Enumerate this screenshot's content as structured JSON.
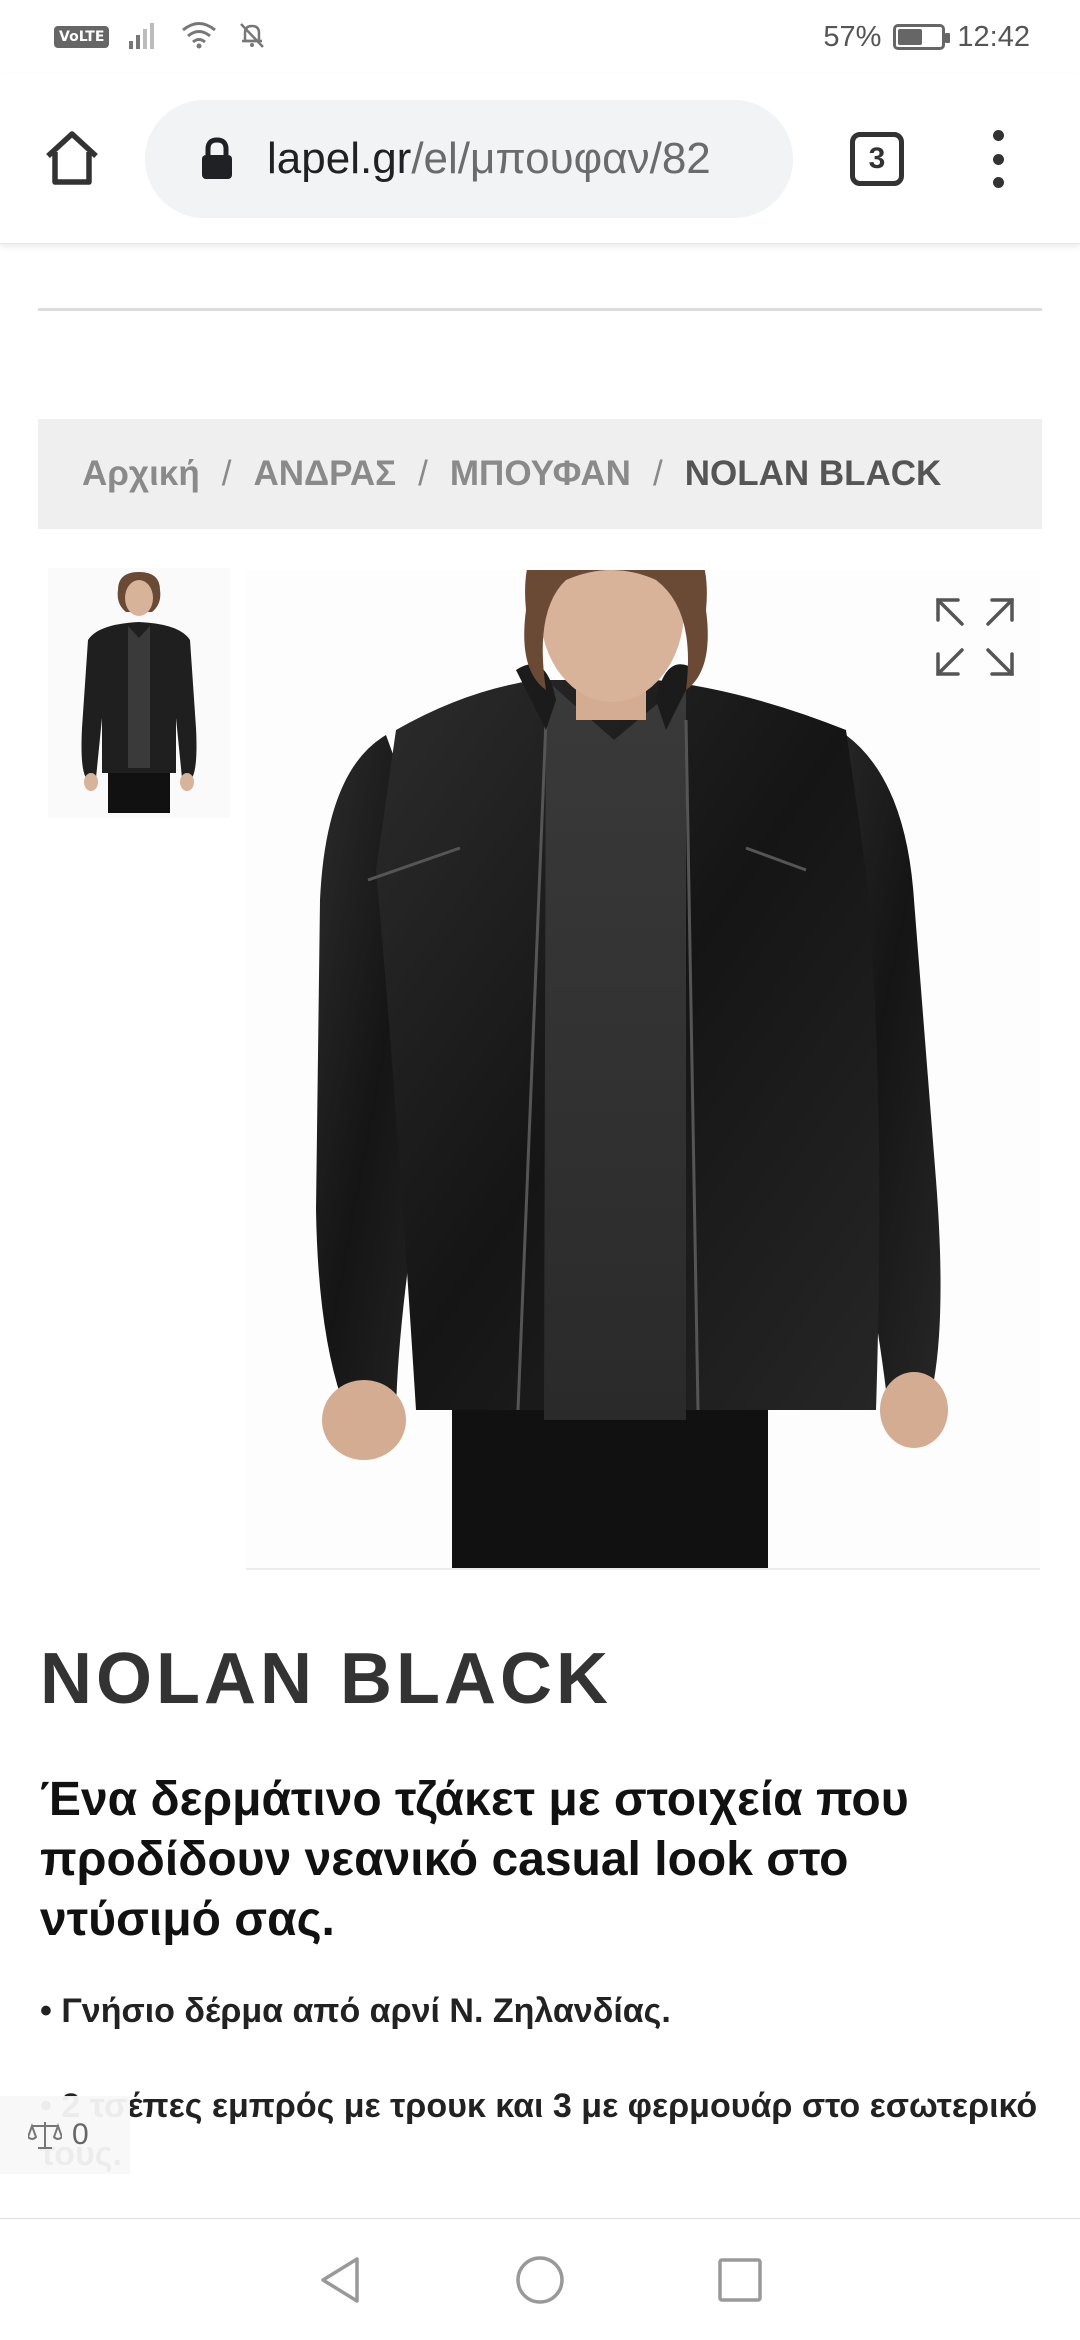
{
  "status_bar": {
    "network_badge": "VoLTE",
    "battery": "57%",
    "battery_level": 0.57,
    "time": "12:42"
  },
  "browser": {
    "url_domain": "lapel.gr",
    "url_path": "/el/μπουφαν/82",
    "tab_count": "3"
  },
  "breadcrumb": {
    "items": [
      "Αρχική",
      "ΑΝΔΡΑΣ",
      "ΜΠΟΥΦΑΝ",
      "NOLAN BLACK"
    ],
    "separator": "/"
  },
  "product": {
    "title": "NOLAN BLACK",
    "description": "Ένα δερμάτινο τζάκετ με στοιχεία που προδίδουν νεανικό casual look  στο ντύσιμό σας.",
    "bullets": [
      "• Γνήσιο δέρμα από αρνί Ν. Ζηλανδίας.",
      "• 2 τσέπες εμπρός με τρουκ και 3 με φερμουάρ στο εσωτερικό τους."
    ]
  },
  "compare": {
    "count": "0"
  },
  "icons": {
    "home": "home-icon",
    "lock": "lock-icon",
    "menu": "more-vert-icon",
    "expand": "fullscreen-icon",
    "compare": "scale-icon",
    "back": "back-triangle-icon",
    "home_nav": "home-circle-icon",
    "recents": "recents-square-icon"
  },
  "colors": {
    "breadcrumb_bg": "#efefef",
    "breadcrumb_text": "#8a8a8a",
    "title": "#333333",
    "url_bg": "#f1f3f4"
  }
}
